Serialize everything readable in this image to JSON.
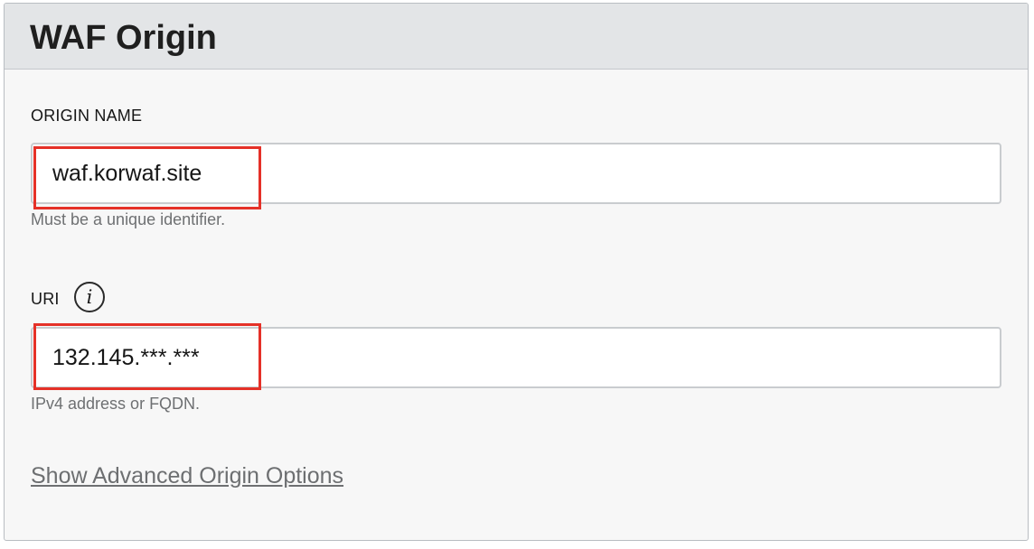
{
  "panel": {
    "title": "WAF Origin"
  },
  "origin_name": {
    "label": "ORIGIN NAME",
    "value": "waf.korwaf.site",
    "help": "Must be a unique identifier."
  },
  "uri": {
    "label": "URI",
    "info_icon": "info-icon",
    "info_glyph": "i",
    "value": "132.145.***.***",
    "help": "IPv4 address or FQDN."
  },
  "advanced_link": "Show Advanced Origin Options",
  "colors": {
    "header_bg": "#e3e5e7",
    "panel_bg": "#f7f7f7",
    "highlight": "#e53128",
    "help_text": "#6e7072"
  }
}
